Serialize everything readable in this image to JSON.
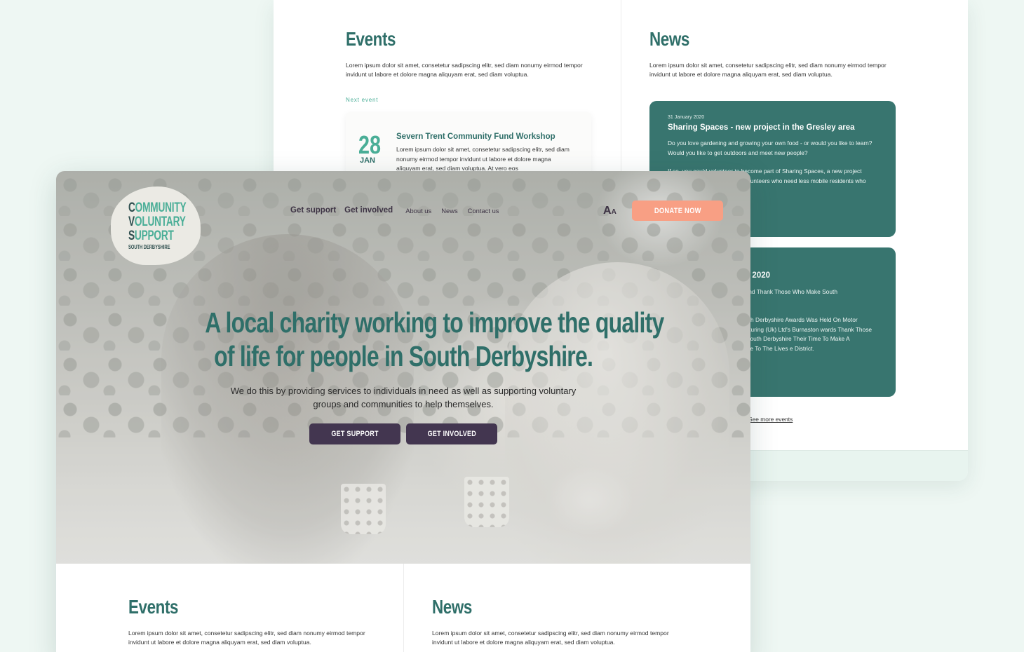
{
  "back_page": {
    "events": {
      "heading": "Events",
      "intro": "Lorem ipsum dolor sit amet, consetetur sadipscing elitr, sed diam nonumy eirmod tempor invidunt ut labore et dolore magna aliquyam erat, sed diam voluptua.",
      "next_event_label": "Next event",
      "next_event": {
        "day": "28",
        "month": "JAN",
        "title": "Severn Trent Community Fund Workshop",
        "description": "Lorem ipsum dolor sit amet, consetetur sadipscing elitr, sed diam nonumy eirmod tempor invidunt ut labore et dolore magna aliquyam erat, sed diam voluptua. At vero eos"
      },
      "see_more": "See more events"
    },
    "news": {
      "heading": "News",
      "intro": "Lorem ipsum dolor sit amet, consetetur sadipscing elitr, sed diam nonumy eirmod tempor invidunt ut labore et dolore magna aliquyam erat, sed diam voluptua.",
      "items": [
        {
          "date": "31 January 2020",
          "title": "Sharing Spaces - new project in the Gresley area",
          "paragraph_1": "Do you love gardening and growing your own food - or would you like to learn? Would you like to get outdoors and meet new people?",
          "paragraph_2": "If so, you could volunteer to become part of Sharing Spaces, a new project which aims to bring together volunteers who need less mobile residents who have a garden"
        },
        {
          "title": "wards 2020",
          "paragraph_1": "ebrate And Thank Those Who Make South",
          "paragraph_2": "The South Derbyshire Awards Was Held On Motor Manufacturing (Uk) Ltd's Burnaston wards Thank Those Across South Derbyshire Their Time To Make A Difference To The Lives e District."
        }
      ]
    }
  },
  "front_page": {
    "logo": {
      "line_1_first": "C",
      "line_1_rest": "OMMUNITY",
      "line_2_first": "V",
      "line_2_rest": "OLUNTARY",
      "line_3_first": "S",
      "line_3_rest": "UPPORT",
      "subtitle": "SOUTH DERBYSHIRE"
    },
    "nav": {
      "get_support": "Get support",
      "get_involved": "Get involved",
      "about_us": "About us",
      "news": "News",
      "contact_us": "Contact us"
    },
    "font_toggle": {
      "big": "A",
      "small": "A"
    },
    "donate_label": "DONATE NOW",
    "hero": {
      "title_line_1": "A local charity working to improve the quality",
      "title_line_2": "of life for people in South Derbyshire.",
      "subtitle": "We do this by providing services to individuals in need as well as supporting voluntary groups and communities to help themselves.",
      "cta_support": "GET SUPPORT",
      "cta_involved": "GET INVOLVED"
    },
    "events": {
      "heading": "Events",
      "intro": "Lorem ipsum dolor sit amet, consetetur sadipscing elitr, sed diam nonumy eirmod tempor invidunt ut labore et dolore magna aliquyam erat, sed diam voluptua."
    },
    "news": {
      "heading": "News",
      "intro": "Lorem ipsum dolor sit amet, consetetur sadipscing elitr, sed diam nonumy eirmod tempor invidunt ut labore et dolore magna aliquyam erat, sed diam voluptua."
    }
  },
  "colors": {
    "background": "#eef7f3",
    "brand_teal": "#2f6f69",
    "accent_green": "#4aae97",
    "news_card": "#38756f",
    "donate": "#f89f84",
    "cta_purple": "#433650"
  }
}
